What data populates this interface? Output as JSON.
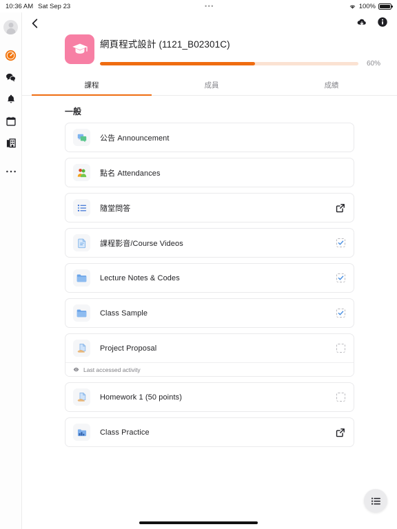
{
  "statusbar": {
    "time": "10:36 AM",
    "date": "Sat Sep 23",
    "dots": "•••",
    "battery_pct": "100%",
    "wifi_icon": "wifi-icon",
    "battery_icon": "battery-icon"
  },
  "appbar": {
    "back_icon": "back-chevron-icon",
    "download_icon": "cloud-download-icon",
    "info_icon": "info-circle-icon"
  },
  "rail": {
    "items": [
      {
        "name": "avatar",
        "icon": "user-avatar-icon"
      },
      {
        "name": "dashboard",
        "icon": "dashboard-gauge-icon"
      },
      {
        "name": "messages",
        "icon": "chat-bubbles-icon"
      },
      {
        "name": "notifications",
        "icon": "bell-icon"
      },
      {
        "name": "calendar",
        "icon": "calendar-icon"
      },
      {
        "name": "sites",
        "icon": "building-grid-icon"
      },
      {
        "name": "more",
        "icon": "more-dots-icon"
      }
    ]
  },
  "course": {
    "title": "網頁程式設計 (1121_B02301C)",
    "badge_icon": "graduation-cap-icon",
    "badge_color": "#f77fa4",
    "progress_percent": 60,
    "progress_label": "60%",
    "progress_color": "#ef6c11",
    "progress_track_color": "#fbe2d2"
  },
  "tabs": [
    {
      "label": "課程",
      "active": true
    },
    {
      "label": "成員",
      "active": false
    },
    {
      "label": "成績",
      "active": false
    }
  ],
  "section": {
    "title": "一般",
    "items": [
      {
        "label": "公告 Announcement",
        "icon": "forum-chat-icon",
        "trailing": "none",
        "footer": null
      },
      {
        "label": "點名 Attendances",
        "icon": "attendance-people-icon",
        "trailing": "none",
        "footer": null
      },
      {
        "label": "隨堂問答",
        "icon": "bullet-list-icon",
        "trailing": "external-link",
        "footer": null
      },
      {
        "label": "課程影音/Course Videos",
        "icon": "page-document-icon",
        "trailing": "checkbox-checked",
        "footer": null
      },
      {
        "label": "Lecture Notes & Codes",
        "icon": "folder-icon",
        "trailing": "checkbox-checked",
        "footer": null
      },
      {
        "label": "Class Sample",
        "icon": "folder-icon",
        "trailing": "checkbox-checked",
        "footer": null
      },
      {
        "label": "Project Proposal",
        "icon": "assignment-icon",
        "trailing": "checkbox-unchecked",
        "footer": "Last accessed activity"
      },
      {
        "label": "Homework 1 (50 points)",
        "icon": "assignment-icon",
        "trailing": "checkbox-unchecked",
        "footer": null
      },
      {
        "label": "Class Practice",
        "icon": "database-icon",
        "trailing": "external-link",
        "footer": null
      }
    ]
  },
  "fab": {
    "icon": "list-menu-icon"
  }
}
